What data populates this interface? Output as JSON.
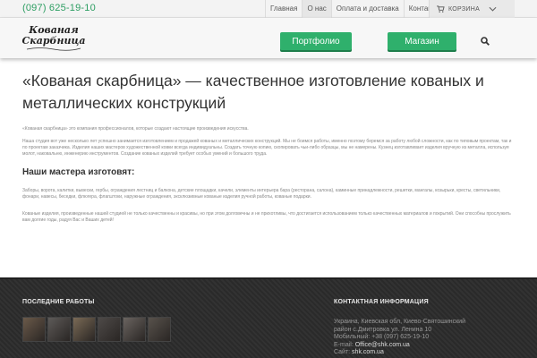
{
  "topbar": {
    "phone": "(097) 625-19-10",
    "nav": [
      {
        "label": "Главная"
      },
      {
        "label": "О нас"
      },
      {
        "label": "Оплата и доставка"
      },
      {
        "label": "Контакты"
      }
    ],
    "cart_label": "КОРЗИНА"
  },
  "header": {
    "logo_line1": "Кованая",
    "logo_line2": "Скарбница",
    "portfolio_label": "Портфолио",
    "shop_label": "Магазин"
  },
  "main": {
    "title": "«Кованая скарбница» — качественное изготовление кованых и металлических конструкций",
    "p1": "«Кованая скарбница» это компания профессионалов, которые создают настоящие произведения искусства.",
    "p2": "Наша студия вот уже несколько лет успешно занимается изготовлением и продажей кованых и металлических конструкций. Мы не боимся работы, именно поэтому беремся за работу любой сложности, как по типовым проектам, так и по проектам заказчика. Изделия наших мастеров художественной ковки всегда индивидуальны. Создать точную копию, скопировать чьи-либо образцы, мы не намерены. Кузнец изготавливает изделия вручную из металла, используя молот, наковальню, инженерию инструментов. Создание кованых изделий требует особых умений и большого труда.",
    "subheading": "Наши мастера изготовят:",
    "p3": "Заборы, ворота, калитки, вывески, гербы, ограждения лестниц и балкона, детские площадки, качели, элементы интерьера бара (ресторана, салона), каминные принадлежности, решетки, мангалы, козырьки, кресты, светильники, фонари, навесы, беседки, флюгера, флагштоки, наружные ограждения, эксклюзивные кованые изделия ручной работы, кованые подарки.",
    "p4": "Кованые изделия, произведенные нашей студией не только качественны и красивы, но при этом долговечны и не прихотливы, что достигается использованием только качественных материалов и покрытий. Они способны прослужить вам долгие годы, радуя Вас и Ваших детей!"
  },
  "footer": {
    "works_title": "ПОСЛЕДНИЕ РАБОТЫ",
    "contacts_title": "КОНТАКТНАЯ ИНФОРМАЦИЯ",
    "address1": "Украина, Киевская обл, Киево-Святошинский",
    "address2": "район с.Дмитровка ул. Ленина 10",
    "mobile_label": "Мобильный:",
    "mobile": "+38 (097) 625-19-10",
    "email_label": "E-mail:",
    "email": "Office@shk.com.ua",
    "site_label": "Сайт:",
    "site": "shk.com.ua",
    "thumb_colors": [
      "#6b5a4a",
      "#5d5a58",
      "#7a6a56",
      "#4e4a48",
      "#6a6460",
      "#58524c"
    ]
  }
}
